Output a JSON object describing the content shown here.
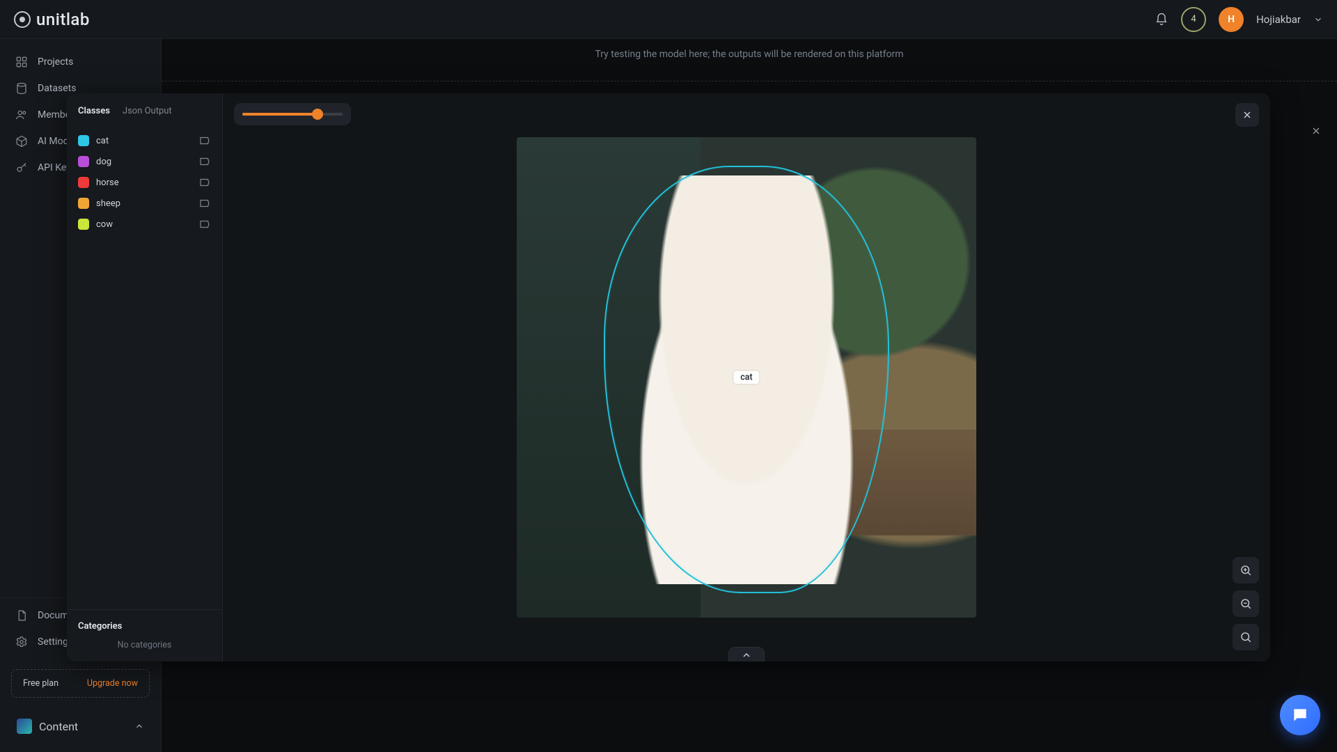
{
  "brand": {
    "name": "unitlab"
  },
  "header": {
    "notification_count": "4",
    "avatar_initial": "H",
    "user_name": "Hojiakbar"
  },
  "sidebar": {
    "items": [
      {
        "label": "Projects",
        "icon": "grid-icon"
      },
      {
        "label": "Datasets",
        "icon": "cylinder-icon"
      },
      {
        "label": "Members",
        "icon": "users-icon"
      },
      {
        "label": "AI Models",
        "icon": "box-icon"
      },
      {
        "label": "API Keys",
        "icon": "key-icon"
      }
    ],
    "bottom": [
      {
        "label": "Documentation",
        "icon": "doc-icon"
      },
      {
        "label": "Settings",
        "icon": "gear-icon"
      }
    ],
    "plan": {
      "name": "Free plan",
      "cta": "Upgrade now"
    },
    "workspace": {
      "label": "Content"
    }
  },
  "backdrop": {
    "hint": "Try testing the model here; the outputs will be rendered on this platform"
  },
  "viewer": {
    "tabs": {
      "classes": "Classes",
      "json": "Json Output"
    },
    "classes": [
      {
        "name": "cat",
        "color": "#2ec7e6"
      },
      {
        "name": "dog",
        "color": "#b84fd9"
      },
      {
        "name": "horse",
        "color": "#ef3a3a"
      },
      {
        "name": "sheep",
        "color": "#f0a636"
      },
      {
        "name": "cow",
        "color": "#cbe63a"
      }
    ],
    "categories": {
      "title": "Categories",
      "empty": "No categories"
    },
    "opacity_percent": 75,
    "detection": {
      "label": "cat"
    },
    "zoom_tools": {
      "in": "zoom-in",
      "out": "zoom-out",
      "fit": "zoom-fit"
    }
  }
}
